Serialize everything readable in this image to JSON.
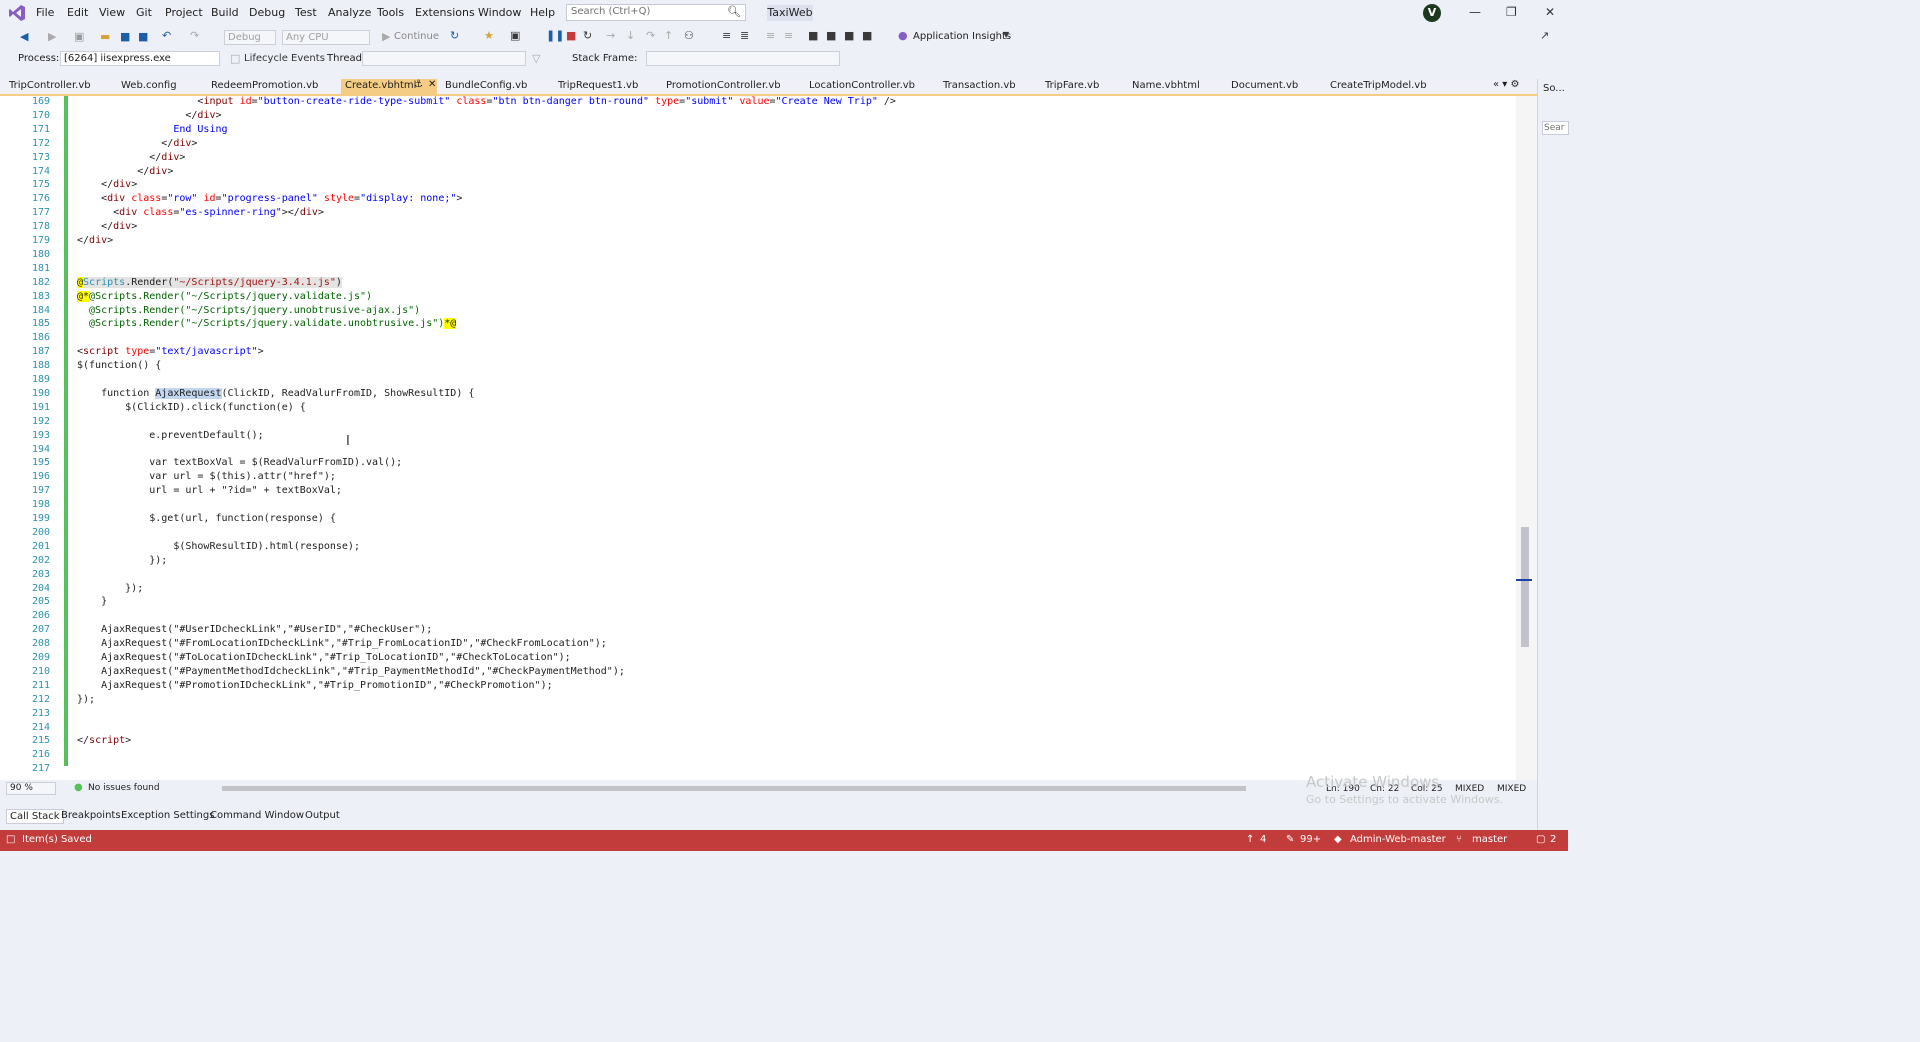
{
  "menu": [
    "File",
    "Edit",
    "View",
    "Git",
    "Project",
    "Build",
    "Debug",
    "Test",
    "Analyze",
    "Tools",
    "Extensions",
    "Window",
    "Help"
  ],
  "search": {
    "placeholder": "Search (Ctrl+Q)"
  },
  "solution_name": "TaxiWeb",
  "avatar_initial": "V",
  "toolbar": {
    "config": "Debug",
    "platform": "Any CPU",
    "continue_label": "Continue",
    "app_insights": "Application Insights"
  },
  "debug_toolbar": {
    "process_label": "Process:",
    "process_value": "[6264] iisexpress.exe",
    "lifecycle": "Lifecycle Events",
    "thread_label": "Thread:",
    "stack_frame_label": "Stack Frame:"
  },
  "tabs": [
    "TripController.vb",
    "Web.config",
    "RedeemPromotion.vb",
    "Create.vbhtml",
    "BundleConfig.vb",
    "TripRequest1.vb",
    "PromotionController.vb",
    "LocationController.vb",
    "Transaction.vb",
    "TripFare.vb",
    "Name.vbhtml",
    "Document.vb",
    "CreateTripModel.vb"
  ],
  "active_tab": "Create.vbhtml",
  "side_panel": {
    "label": "So...",
    "search": "Sear"
  },
  "code_lines": [
    {
      "n": "169",
      "html": "                    &lt;<span class='tagc'>input</span> <span class='attr'>id</span>=<span class='kw'>\"button-create-ride-type-submit\"</span> <span class='attr'>class</span>=<span class='kw'>\"btn btn-danger btn-round\"</span> <span class='attr'>type</span>=<span class='kw'>\"submit\"</span> <span class='attr'>value</span>=<span class='kw'>\"Create New Trip\"</span> /&gt;"
    },
    {
      "n": "170",
      "html": "                  &lt;/<span class='tagc'>div</span>&gt;"
    },
    {
      "n": "171",
      "html": "                <span class='kw'>End Using</span>"
    },
    {
      "n": "172",
      "html": "              &lt;/<span class='tagc'>div</span>&gt;"
    },
    {
      "n": "173",
      "html": "            &lt;/<span class='tagc'>div</span>&gt;"
    },
    {
      "n": "174",
      "html": "          &lt;/<span class='tagc'>div</span>&gt;"
    },
    {
      "n": "175",
      "html": "    &lt;/<span class='tagc'>div</span>&gt;"
    },
    {
      "n": "176",
      "html": "    &lt;<span class='tagc'>div</span> <span class='attr'>class</span>=<span class='kw'>\"row\"</span> <span class='attr'>id</span>=<span class='kw'>\"progress-panel\"</span> <span class='attr'>style</span>=<span class='kw'>\"display: none;\"</span>&gt;"
    },
    {
      "n": "177",
      "html": "      &lt;<span class='tagc'>div</span> <span class='attr'>class</span>=<span class='kw'>\"es-spinner-ring\"</span>&gt;&lt;/<span class='tagc'>div</span>&gt;"
    },
    {
      "n": "178",
      "html": "    &lt;/<span class='tagc'>div</span>&gt;"
    },
    {
      "n": "179",
      "html": "&lt;/<span class='tagc'>div</span>&gt;"
    },
    {
      "n": "180",
      "html": ""
    },
    {
      "n": "181",
      "html": ""
    },
    {
      "n": "182",
      "html": "<span class='razor'>@</span><span class='rz-bg'><span style='color:#2b91af'>Scripts</span>.Render(<span class='str'>\"~/Scripts/jquery-3.4.1.js\"</span>)</span>"
    },
    {
      "n": "183",
      "html": "<span class='razor'>@*</span><span style='color:#006400'>@Scripts.Render(\"~/Scripts/jquery.validate.js\")</span>"
    },
    {
      "n": "184",
      "html": "<span style='color:#006400'>  @Scripts.Render(\"~/Scripts/jquery.unobtrusive-ajax.js\")</span>"
    },
    {
      "n": "185",
      "html": "<span style='color:#006400'>  @Scripts.Render(\"~/Scripts/jquery.validate.unobtrusive.js\")</span><span class='razor'>*@</span>"
    },
    {
      "n": "186",
      "html": ""
    },
    {
      "n": "187",
      "html": "&lt;<span class='tagc'>script</span> <span class='attr'>type</span>=<span class='kw'>\"text/javascript\"</span>&gt;"
    },
    {
      "n": "188",
      "html": "$(function() {"
    },
    {
      "n": "189",
      "html": ""
    },
    {
      "n": "190",
      "html": "    function <span class='hl'>AjaxRequest</span>(ClickID, ReadValurFromID, ShowResultID) {"
    },
    {
      "n": "191",
      "html": "        $(ClickID).click(function(e) {"
    },
    {
      "n": "192",
      "html": ""
    },
    {
      "n": "193",
      "html": "            e.preventDefault();"
    },
    {
      "n": "194",
      "html": ""
    },
    {
      "n": "195",
      "html": "            var textBoxVal = $(ReadValurFromID).val();"
    },
    {
      "n": "196",
      "html": "            var url = $(this).attr(\"href\");"
    },
    {
      "n": "197",
      "html": "            url = url + \"?id=\" + textBoxVal;"
    },
    {
      "n": "198",
      "html": ""
    },
    {
      "n": "199",
      "html": "            $.get(url, function(response) {"
    },
    {
      "n": "200",
      "html": ""
    },
    {
      "n": "201",
      "html": "                $(ShowResultID).html(response);"
    },
    {
      "n": "202",
      "html": "            });"
    },
    {
      "n": "203",
      "html": ""
    },
    {
      "n": "204",
      "html": "        });"
    },
    {
      "n": "205",
      "html": "    }"
    },
    {
      "n": "206",
      "html": ""
    },
    {
      "n": "207",
      "html": "    AjaxRequest(\"#UserIDcheckLink\",\"#UserID\",\"#CheckUser\");"
    },
    {
      "n": "208",
      "html": "    AjaxRequest(\"#FromLocationIDcheckLink\",\"#Trip_FromLocationID\",\"#CheckFromLocation\");"
    },
    {
      "n": "209",
      "html": "    AjaxRequest(\"#ToLocationIDcheckLink\",\"#Trip_ToLocationID\",\"#CheckToLocation\");"
    },
    {
      "n": "210",
      "html": "    AjaxRequest(\"#PaymentMethodIdcheckLink\",\"#Trip_PaymentMethodId\",\"#CheckPaymentMethod\");"
    },
    {
      "n": "211",
      "html": "    AjaxRequest(\"#PromotionIDcheckLink\",\"#Trip_PromotionID\",\"#CheckPromotion\");"
    },
    {
      "n": "212",
      "html": "});"
    },
    {
      "n": "213",
      "html": ""
    },
    {
      "n": "214",
      "html": ""
    },
    {
      "n": "215",
      "html": "&lt;/<span class='tagc'>script</span>&gt;"
    },
    {
      "n": "216",
      "html": ""
    },
    {
      "n": "217",
      "html": ""
    }
  ],
  "editor_status": {
    "zoom": "90 %",
    "issues": "No issues found",
    "line": "Ln: 190",
    "char": "Ch: 22",
    "col": "Col: 25",
    "eol1": "MIXED",
    "eol2": "MIXED"
  },
  "watermark": {
    "title": "Activate Windows",
    "subtitle": "Go to Settings to activate Windows."
  },
  "tool_windows": [
    "Call Stack",
    "Breakpoints",
    "Exception Settings",
    "Command Window",
    "Output"
  ],
  "statusbar": {
    "message": "Item(s) Saved",
    "up_count": "4",
    "edit_count": "99+",
    "repo": "Admin-Web-master",
    "branch": "master",
    "notifications": "2"
  }
}
